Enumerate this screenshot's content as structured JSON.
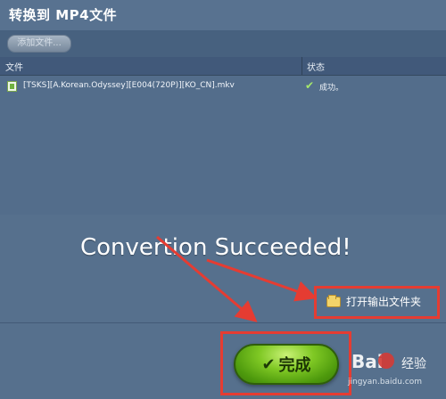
{
  "window": {
    "title": "转换到 MP4文件"
  },
  "toolbar": {
    "add_file_label": "添加文件..."
  },
  "table": {
    "columns": [
      "文件",
      "状态"
    ],
    "rows": [
      {
        "filename": "[TSKS][A.Korean.Odyssey][E004(720P)][KO_CN].mkv",
        "status": "成功。",
        "status_icon": "check-icon"
      }
    ]
  },
  "annotation": {
    "text": "Convertion Succeeded!"
  },
  "actions": {
    "open_folder_label": "打开输出文件夹",
    "done_label": "完成"
  },
  "watermark": {
    "brand": "Bai",
    "jingyan": "经验",
    "url": "jingyan.baidu.com"
  },
  "colors": {
    "highlight": "#e53c32",
    "done_button": "#5fae16",
    "success_check": "#a6e86b"
  }
}
